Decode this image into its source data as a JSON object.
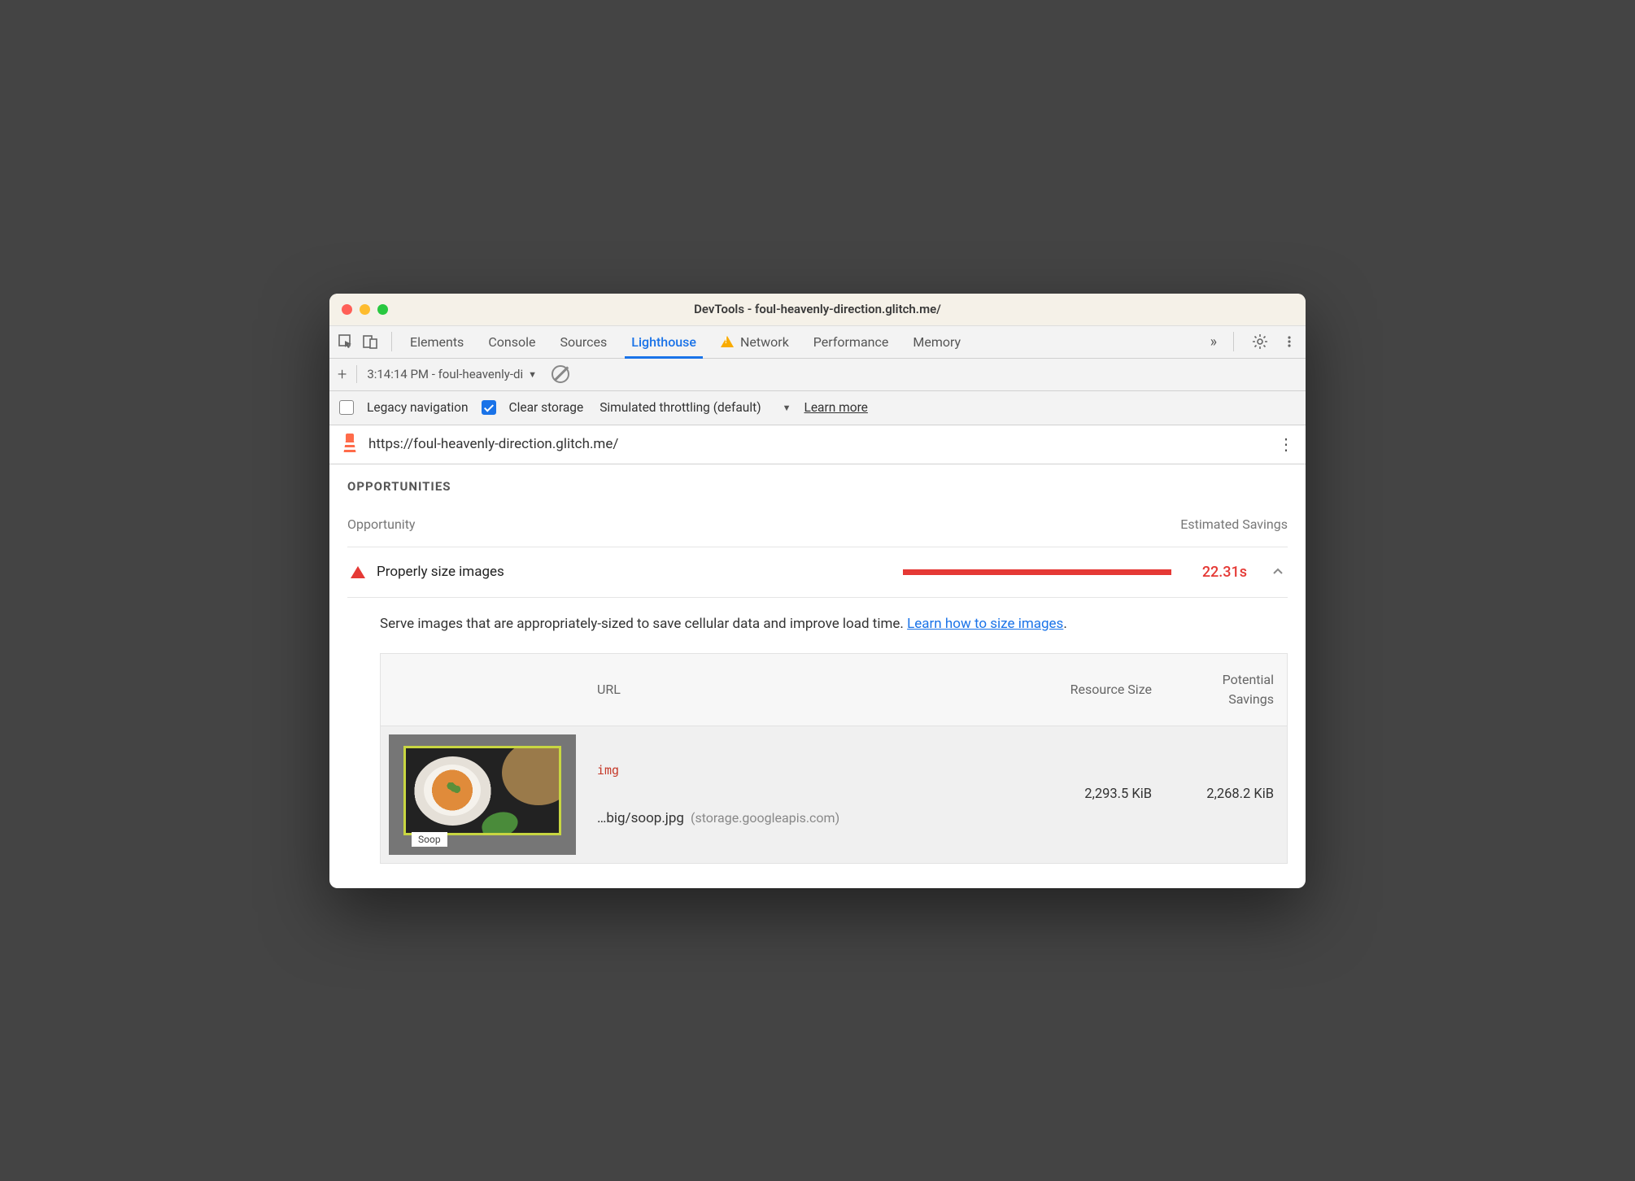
{
  "window": {
    "title": "DevTools - foul-heavenly-direction.glitch.me/"
  },
  "tabs": {
    "items": [
      "Elements",
      "Console",
      "Sources",
      "Lighthouse",
      "Network",
      "Performance",
      "Memory"
    ],
    "active": "Lighthouse",
    "network_warn": true
  },
  "sub_toolbar": {
    "report_label": "3:14:14 PM - foul-heavenly-di"
  },
  "options": {
    "legacy_nav_label": "Legacy navigation",
    "clear_storage_label": "Clear storage",
    "clear_storage_checked": true,
    "throttling_label": "Simulated throttling (default)",
    "learn_more": "Learn more"
  },
  "url_bar": {
    "url": "https://foul-heavenly-direction.glitch.me/"
  },
  "section": {
    "title": "OPPORTUNITIES",
    "col_opportunity": "Opportunity",
    "col_savings": "Estimated Savings"
  },
  "opportunity": {
    "label": "Properly size images",
    "savings_time": "22.31s",
    "description_pre": "Serve images that are appropriately-sized to save cellular data and improve load time. ",
    "description_link": "Learn how to size images",
    "description_post": "."
  },
  "table": {
    "headers": {
      "url": "URL",
      "resource_size": "Resource Size",
      "potential_savings": "Potential Savings"
    },
    "rows": [
      {
        "tag": "img",
        "path": "…big/soop.jpg",
        "host": "(storage.googleapis.com)",
        "resource_size": "2,293.5 KiB",
        "potential_savings": "2,268.2 KiB",
        "thumb_label": "Soop"
      }
    ]
  }
}
